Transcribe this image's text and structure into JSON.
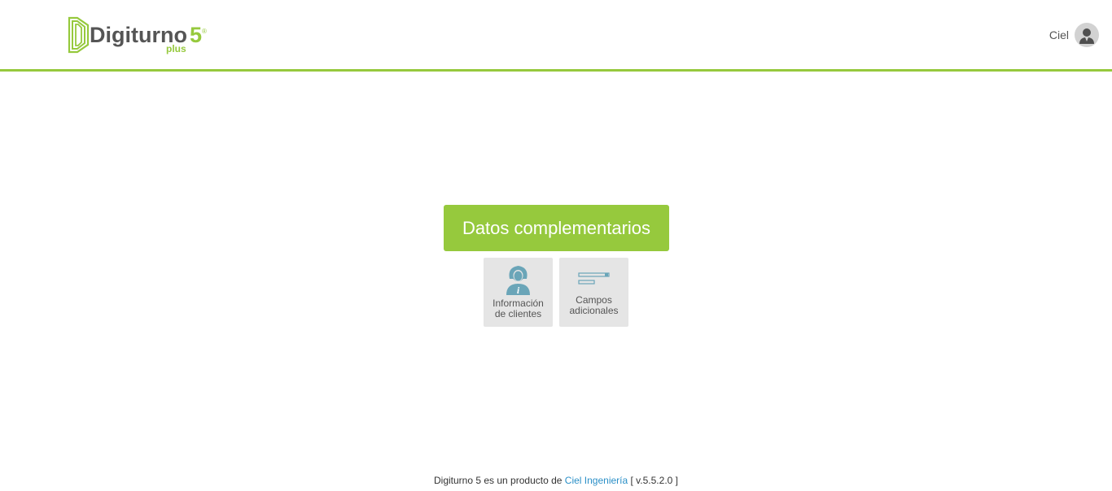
{
  "header": {
    "logo": {
      "brand": "Digiturno",
      "version": "5",
      "registered": "®",
      "edition": "plus"
    },
    "user": {
      "name": "Ciel",
      "avatar_icon": "user-avatar-icon"
    }
  },
  "main": {
    "title": "Datos complementarios",
    "tiles": [
      {
        "label_line1": "Información",
        "label_line2": "de clientes",
        "icon": "client-info-icon"
      },
      {
        "label_line1": "Campos",
        "label_line2": "adicionales",
        "icon": "additional-fields-icon"
      }
    ]
  },
  "footer": {
    "prefix": "Digiturno 5 es un producto de",
    "company": "Ciel Ingeniería",
    "version": "[ v.5.5.2.0 ]"
  },
  "colors": {
    "accent": "#96c93d",
    "link": "#2a8fc7",
    "tile_bg": "#e5e5e5",
    "icon": "#6aa5b8"
  }
}
